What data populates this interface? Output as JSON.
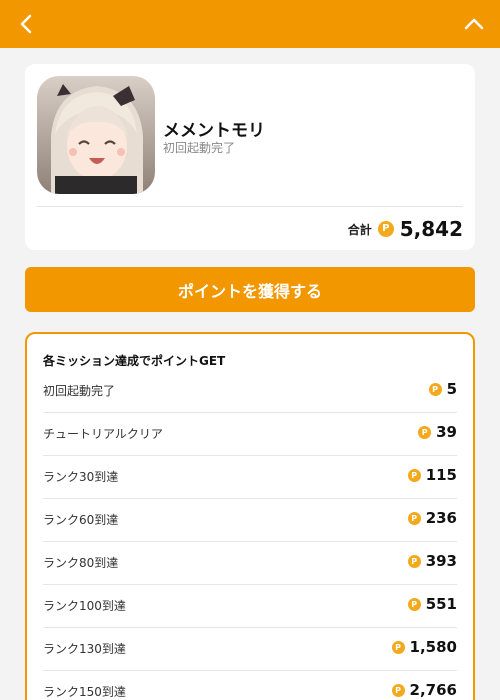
{
  "header": {
    "back_icon": "chevron-left-icon",
    "collapse_icon": "chevron-up-icon",
    "color": "#f39700"
  },
  "app": {
    "name": "メメントモリ",
    "status": "初回起動完了",
    "total_label": "合計",
    "total_value": "5,842",
    "coin_symbol": "P"
  },
  "cta": {
    "label": "ポイントを獲得する"
  },
  "missions": {
    "title": "各ミッション達成でポイントGET",
    "items": [
      {
        "name": "初回起動完了",
        "points": "5"
      },
      {
        "name": "チュートリアルクリア",
        "points": "39"
      },
      {
        "name": "ランク30到達",
        "points": "115"
      },
      {
        "name": "ランク60到達",
        "points": "236"
      },
      {
        "name": "ランク80到達",
        "points": "393"
      },
      {
        "name": "ランク100到達",
        "points": "551"
      },
      {
        "name": "ランク130到達",
        "points": "1,580"
      },
      {
        "name": "ランク150到達",
        "points": "2,766"
      }
    ]
  }
}
